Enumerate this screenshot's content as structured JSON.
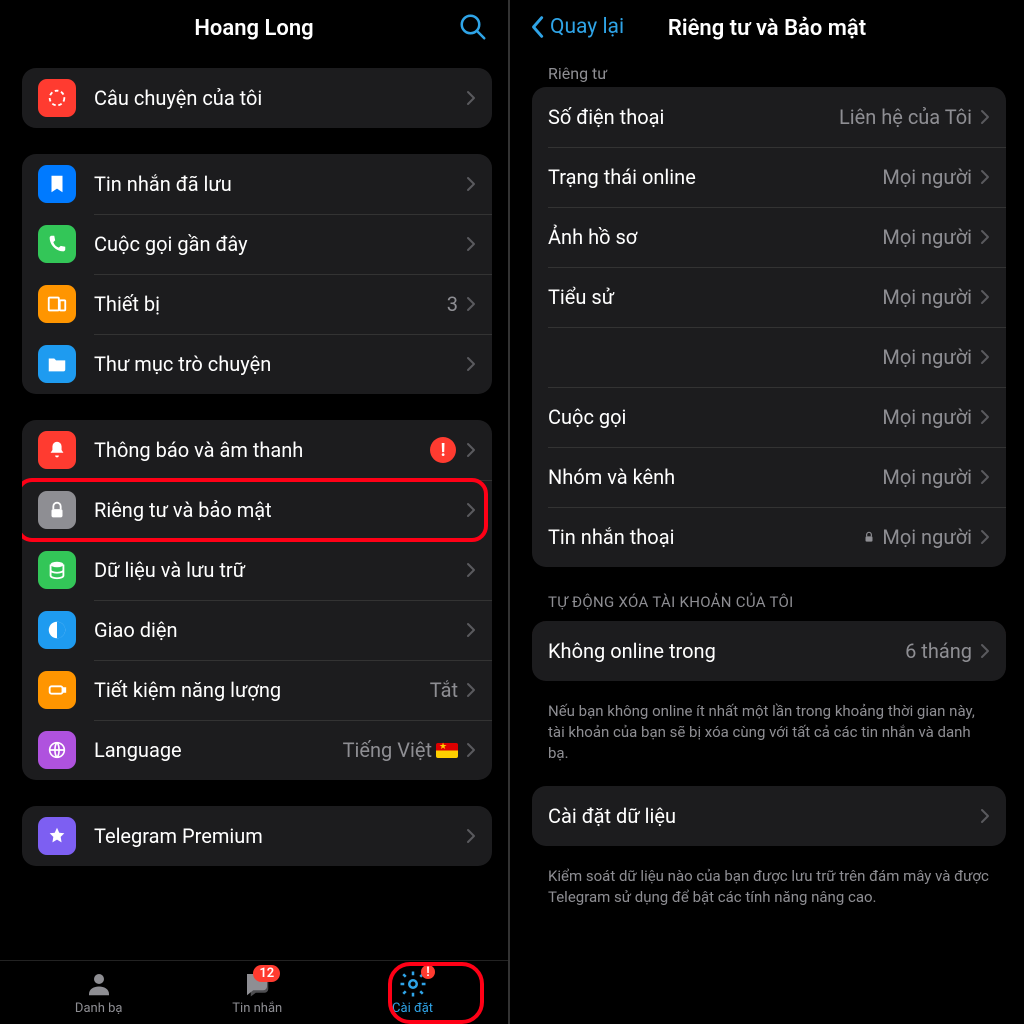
{
  "left": {
    "title": "Hoang Long",
    "groups": [
      {
        "rows": [
          {
            "icon": "story",
            "bg": "#ff3b30",
            "label": "Câu chuyện của tôi"
          }
        ]
      },
      {
        "rows": [
          {
            "icon": "bookmark",
            "bg": "#007aff",
            "label": "Tin nhắn đã lưu"
          },
          {
            "icon": "phone",
            "bg": "#33c658",
            "label": "Cuộc gọi gần đây"
          },
          {
            "icon": "devices",
            "bg": "#ff9500",
            "label": "Thiết bị",
            "value": "3"
          },
          {
            "icon": "folder",
            "bg": "#1e9bf0",
            "label": "Thư mục trò chuyện"
          }
        ]
      },
      {
        "rows": [
          {
            "icon": "bell",
            "bg": "#ff3b30",
            "label": "Thông báo và âm thanh",
            "alert": "!"
          },
          {
            "icon": "lock",
            "bg": "#8e8e93",
            "label": "Riêng tư và bảo mật",
            "highlight": true
          },
          {
            "icon": "data",
            "bg": "#33c658",
            "label": "Dữ liệu và lưu trữ"
          },
          {
            "icon": "appearance",
            "bg": "#1e9bf0",
            "label": "Giao diện"
          },
          {
            "icon": "battery",
            "bg": "#ff9500",
            "label": "Tiết kiệm năng lượng",
            "value": "Tắt"
          },
          {
            "icon": "globe",
            "bg": "#af52de",
            "label": "Language",
            "value": "Tiếng Việt",
            "flag": true
          }
        ]
      },
      {
        "rows": [
          {
            "icon": "star",
            "bg": "#7d5ff2",
            "label": "Telegram Premium"
          }
        ]
      }
    ],
    "tabs": [
      {
        "icon": "contacts",
        "label": "Danh bạ"
      },
      {
        "icon": "chats",
        "label": "Tin nhắn",
        "badge": "12"
      },
      {
        "icon": "settings",
        "label": "Cài đặt",
        "active": true,
        "alert": true,
        "highlight": true
      }
    ]
  },
  "right": {
    "back": "Quay lại",
    "title": "Riêng tư và Bảo mật",
    "mini": "Riêng tư",
    "privacy_rows": [
      {
        "label": "Số điện thoại",
        "value": "Liên hệ của Tôi"
      },
      {
        "label": "Trạng thái online",
        "value": "Mọi người"
      },
      {
        "label": "Ảnh hồ sơ",
        "value": "Mọi người"
      },
      {
        "label": "Tiểu sử",
        "value": "Mọi người"
      },
      {
        "label": "",
        "value": "Mọi người"
      },
      {
        "label": "Cuộc gọi",
        "value": "Mọi người"
      },
      {
        "label": "Nhóm và kênh",
        "value": "Mọi người"
      },
      {
        "label": "Tin nhắn thoại",
        "value": "Mọi người",
        "locked": true
      }
    ],
    "auto_delete_header": "TỰ ĐỘNG XÓA TÀI KHOẢN CỦA TÔI",
    "auto_delete_row": {
      "label": "Không online trong",
      "value": "6 tháng",
      "highlight": true
    },
    "auto_delete_footer": "Nếu bạn không online ít nhất một lần trong khoảng thời gian này, tài khoản của bạn sẽ bị xóa cùng với tất cả các tin nhắn và danh bạ.",
    "data_row": {
      "label": "Cài đặt dữ liệu"
    },
    "data_footer": "Kiểm soát dữ liệu nào của bạn được lưu trữ trên đám mây và được Telegram sử dụng để bật các tính năng nâng cao."
  }
}
